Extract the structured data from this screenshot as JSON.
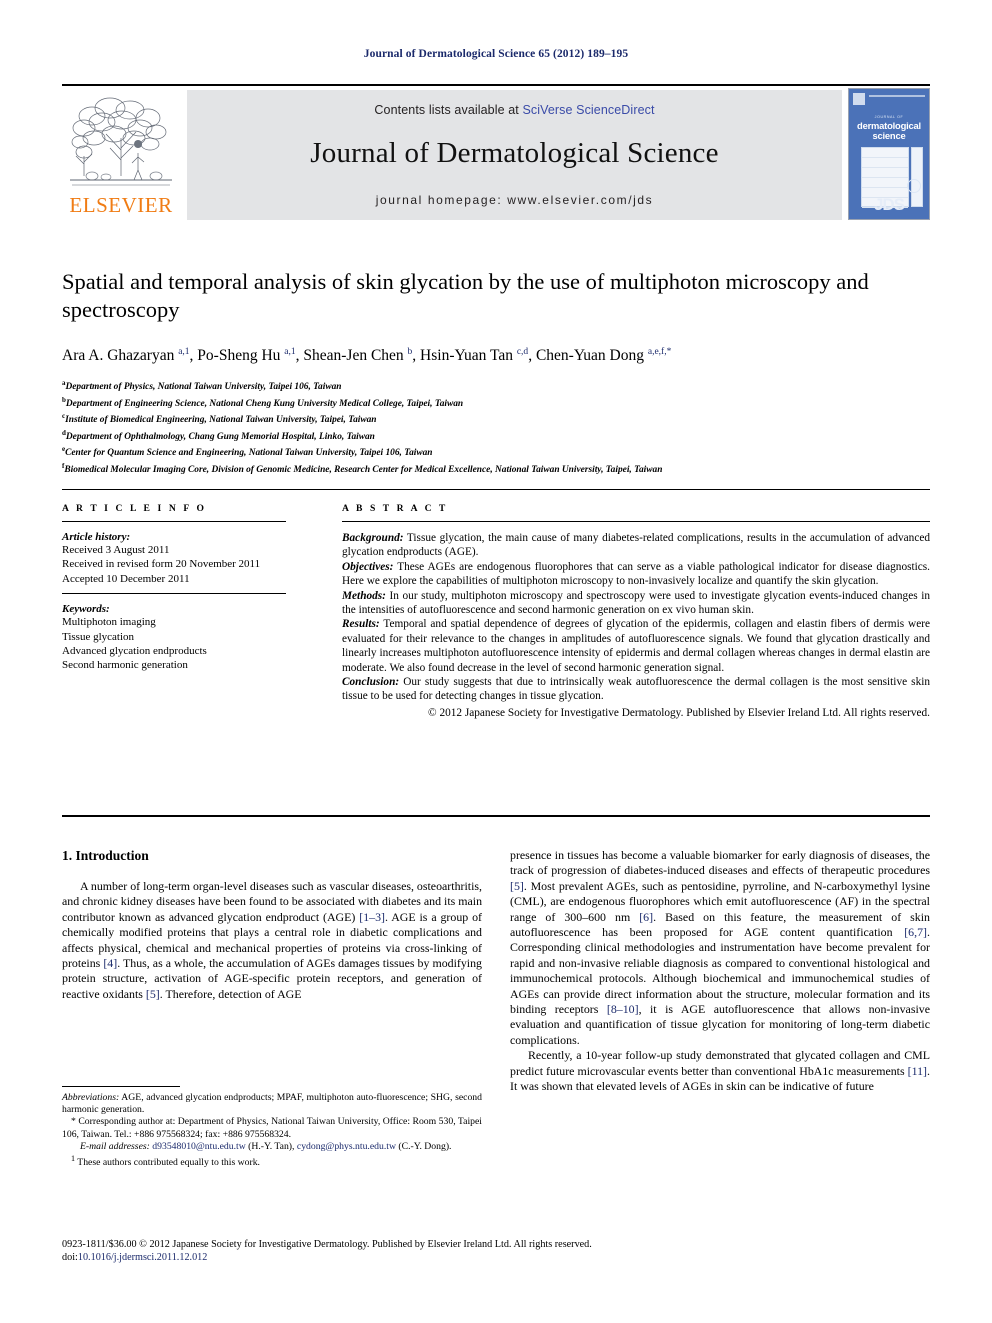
{
  "running_head": "Journal of Dermatological Science 65 (2012) 189–195",
  "masthead": {
    "contents_prefix": "Contents lists available at ",
    "sciencedirect_link": "SciVerse ScienceDirect",
    "journal_title": "Journal of Dermatological Science",
    "homepage": "journal homepage: www.elsevier.com/jds",
    "publisher_logo_text": "ELSEVIER",
    "cover": {
      "kicker": "JOURNAL OF",
      "line1": "dermatological",
      "line2": "science",
      "mark": "JDS"
    }
  },
  "article": {
    "title": "Spatial and temporal analysis of skin glycation by the use of multiphoton microscopy and spectroscopy",
    "authors_html": "Ara A. Ghazaryan <sup>a,1</sup>, Po-Sheng Hu <sup>a,1</sup>, Shean-Jen Chen <sup>b</sup>, Hsin-Yuan Tan <sup>c,d</sup>, Chen-Yuan Dong <sup>a,e,f,</sup><sup>*</sup>",
    "affiliations": [
      {
        "mark": "a",
        "text": "Department of Physics, National Taiwan University, Taipei 106, Taiwan"
      },
      {
        "mark": "b",
        "text": "Department of Engineering Science, National Cheng Kung University Medical College, Taipei, Taiwan"
      },
      {
        "mark": "c",
        "text": "Institute of Biomedical Engineering, National Taiwan University, Taipei, Taiwan"
      },
      {
        "mark": "d",
        "text": "Department of Ophthalmology, Chang Gung Memorial Hospital, Linko, Taiwan"
      },
      {
        "mark": "e",
        "text": "Center for Quantum Science and Engineering, National Taiwan University, Taipei 106, Taiwan"
      },
      {
        "mark": "f",
        "text": "Biomedical Molecular Imaging Core, Division of Genomic Medicine, Research Center for Medical Excellence, National Taiwan University, Taipei, Taiwan"
      }
    ]
  },
  "article_info": {
    "heading": "A R T I C L E  I N F O",
    "history_label": "Article history:",
    "history": [
      "Received 3 August 2011",
      "Received in revised form 20 November 2011",
      "Accepted 10 December 2011"
    ],
    "keywords_label": "Keywords:",
    "keywords": [
      "Multiphoton imaging",
      "Tissue glycation",
      "Advanced glycation endproducts",
      "Second harmonic generation"
    ]
  },
  "abstract": {
    "heading": "A B S T R A C T",
    "sections": [
      {
        "label": "Background:",
        "text": " Tissue glycation, the main cause of many diabetes-related complications, results in the accumulation of advanced glycation endproducts (AGE)."
      },
      {
        "label": "Objectives:",
        "text": " These AGEs are endogenous fluorophores that can serve as a viable pathological indicator for disease diagnostics. Here we explore the capabilities of multiphoton microscopy to non-invasively localize and quantify the skin glycation."
      },
      {
        "label": "Methods:",
        "text": " In our study, multiphoton microscopy and spectroscopy were used to investigate glycation events-induced changes in the intensities of autofluorescence and second harmonic generation on ex vivo human skin."
      },
      {
        "label": "Results:",
        "text": " Temporal and spatial dependence of degrees of glycation of the epidermis, collagen and elastin fibers of dermis were evaluated for their relevance to the changes in amplitudes of autofluorescence signals. We found that glycation drastically and linearly increases multiphoton autofluorescence intensity of epidermis and dermal collagen whereas changes in dermal elastin are moderate. We also found decrease in the level of second harmonic generation signal."
      },
      {
        "label": "Conclusion:",
        "text": " Our study suggests that due to intrinsically weak autofluorescence the dermal collagen is the most sensitive skin tissue to be used for detecting changes in tissue glycation."
      }
    ],
    "copyright": "© 2012 Japanese Society for Investigative Dermatology. Published by Elsevier Ireland Ltd. All rights reserved."
  },
  "body": {
    "section_heading": "1. Introduction",
    "left_paragraphs": [
      "A number of long-term organ-level diseases such as vascular diseases, osteoarthritis, and chronic kidney diseases have been found to be associated with diabetes and its main contributor known as advanced glycation endproduct (AGE) [1–3]. AGE is a group of chemically modified proteins that plays a central role in diabetic complications and affects physical, chemical and mechanical properties of proteins via cross-linking of proteins [4]. Thus, as a whole, the accumulation of AGEs damages tissues by modifying protein structure, activation of AGE-specific protein receptors, and generation of reactive oxidants [5]. Therefore, detection of AGE"
    ],
    "right_paragraphs": [
      "presence in tissues has become a valuable biomarker for early diagnosis of diseases, the track of progression of diabetes-induced diseases and effects of therapeutic procedures [5]. Most prevalent AGEs, such as pentosidine, pyrroline, and N-carboxymethyl lysine (CML), are endogenous fluorophores which emit autofluorescence (AF) in the spectral range of 300–600 nm [6]. Based on this feature, the measurement of skin autofluorescence has been proposed for AGE content quantification [6,7]. Corresponding clinical methodologies and instrumentation have become prevalent for rapid and non-invasive reliable diagnosis as compared to conventional histological and immunochemical protocols. Although biochemical and immunochemical studies of AGEs can provide direct information about the structure, molecular formation and its binding receptors [8–10], it is AGE autofluorescence that allows non-invasive evaluation and quantification of tissue glycation for monitoring of long-term diabetic complications.",
      "Recently, a 10-year follow-up study demonstrated that glycated collagen and CML predict future microvascular events better than conventional HbA1c measurements [11]. It was shown that elevated levels of AGEs in skin can be indicative of future"
    ]
  },
  "footnotes": {
    "abbreviations_label": "Abbreviations:",
    "abbreviations_text": " AGE, advanced glycation endproducts; MPAF, multiphoton auto-fluorescence; SHG, second harmonic generation.",
    "corresponding_mark": "*",
    "corresponding_text": " Corresponding author at: Department of Physics, National Taiwan University, Office: Room 530, Taipei 106, Taiwan. Tel.: +886 975568324; fax: +886 975568324.",
    "email_label": "E-mail addresses:",
    "email_1": "d93548010@ntu.edu.tw",
    "email_1_owner": " (H.-Y. Tan), ",
    "email_2": "cydong@phys.ntu.edu.tw",
    "email_2_owner": " (C.-Y. Dong).",
    "equal_mark": "1",
    "equal_text": " These authors contributed equally to this work."
  },
  "bottom": {
    "issn_line": "0923-1811/$36.00 © 2012 Japanese Society for Investigative Dermatology. Published by Elsevier Ireland Ltd. All rights reserved.",
    "doi_prefix": "doi:",
    "doi_value": "10.1016/j.jdermsci.2011.12.012"
  },
  "colors": {
    "link_blue": "#1b2a6b",
    "sciencedirect_blue": "#3a4ba8",
    "elsevier_orange": "#f07c14",
    "band_gray": "#e3e4e6",
    "cover_blue": "#4b72b8"
  }
}
